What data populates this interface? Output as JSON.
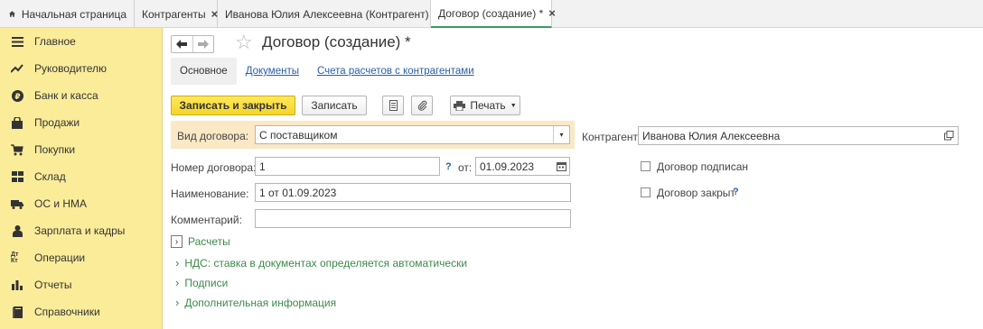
{
  "tabs": [
    {
      "label": "Начальная страница",
      "icon": "home-icon",
      "closable": false
    },
    {
      "label": "Контрагенты",
      "closable": true
    },
    {
      "label": "Иванова Юлия Алексеевна (Контрагент)",
      "closable": true
    },
    {
      "label": "Договор (создание) *",
      "closable": true,
      "active": true
    }
  ],
  "close_symbol": "×",
  "sidebar": {
    "items": [
      {
        "label": "Главное",
        "icon": "menu-icon"
      },
      {
        "label": "Руководителю",
        "icon": "trend-icon"
      },
      {
        "label": "Банк и касса",
        "icon": "ruble-icon"
      },
      {
        "label": "Продажи",
        "icon": "bag-icon"
      },
      {
        "label": "Покупки",
        "icon": "cart-icon"
      },
      {
        "label": "Склад",
        "icon": "warehouse-icon"
      },
      {
        "label": "ОС и НМА",
        "icon": "truck-icon"
      },
      {
        "label": "Зарплата и кадры",
        "icon": "person-icon"
      },
      {
        "label": "Операции",
        "icon": "dt-kt-icon",
        "icon_text": "Дт Кт"
      },
      {
        "label": "Отчеты",
        "icon": "bar-chart-icon"
      },
      {
        "label": "Справочники",
        "icon": "book-icon"
      }
    ]
  },
  "form": {
    "title": "Договор (создание) *",
    "tabs": [
      "Основное",
      "Документы",
      "Счета расчетов с контрагентами"
    ],
    "toolbar": {
      "save_close": "Записать и закрыть",
      "save": "Записать",
      "print": "Печать"
    },
    "fields": {
      "contract_type_label": "Вид договора:",
      "contract_type_value": "С поставщиком",
      "counterparty_label": "Контрагент:",
      "counterparty_value": "Иванова Юлия Алексеевна",
      "number_label": "Номер договора:",
      "number_value": "1",
      "date_from_label": "от:",
      "date_value": "01.09.2023",
      "name_label": "Наименование:",
      "name_value": "1 от 01.09.2023",
      "comment_label": "Комментарий:",
      "comment_value": "",
      "signed_label": "Договор подписан",
      "closed_label": "Договор закрыт",
      "help_mark": "?"
    },
    "sections": [
      "Расчеты",
      "НДС: ставка в документах определяется автоматически",
      "Подписи",
      "Дополнительная информация"
    ]
  }
}
